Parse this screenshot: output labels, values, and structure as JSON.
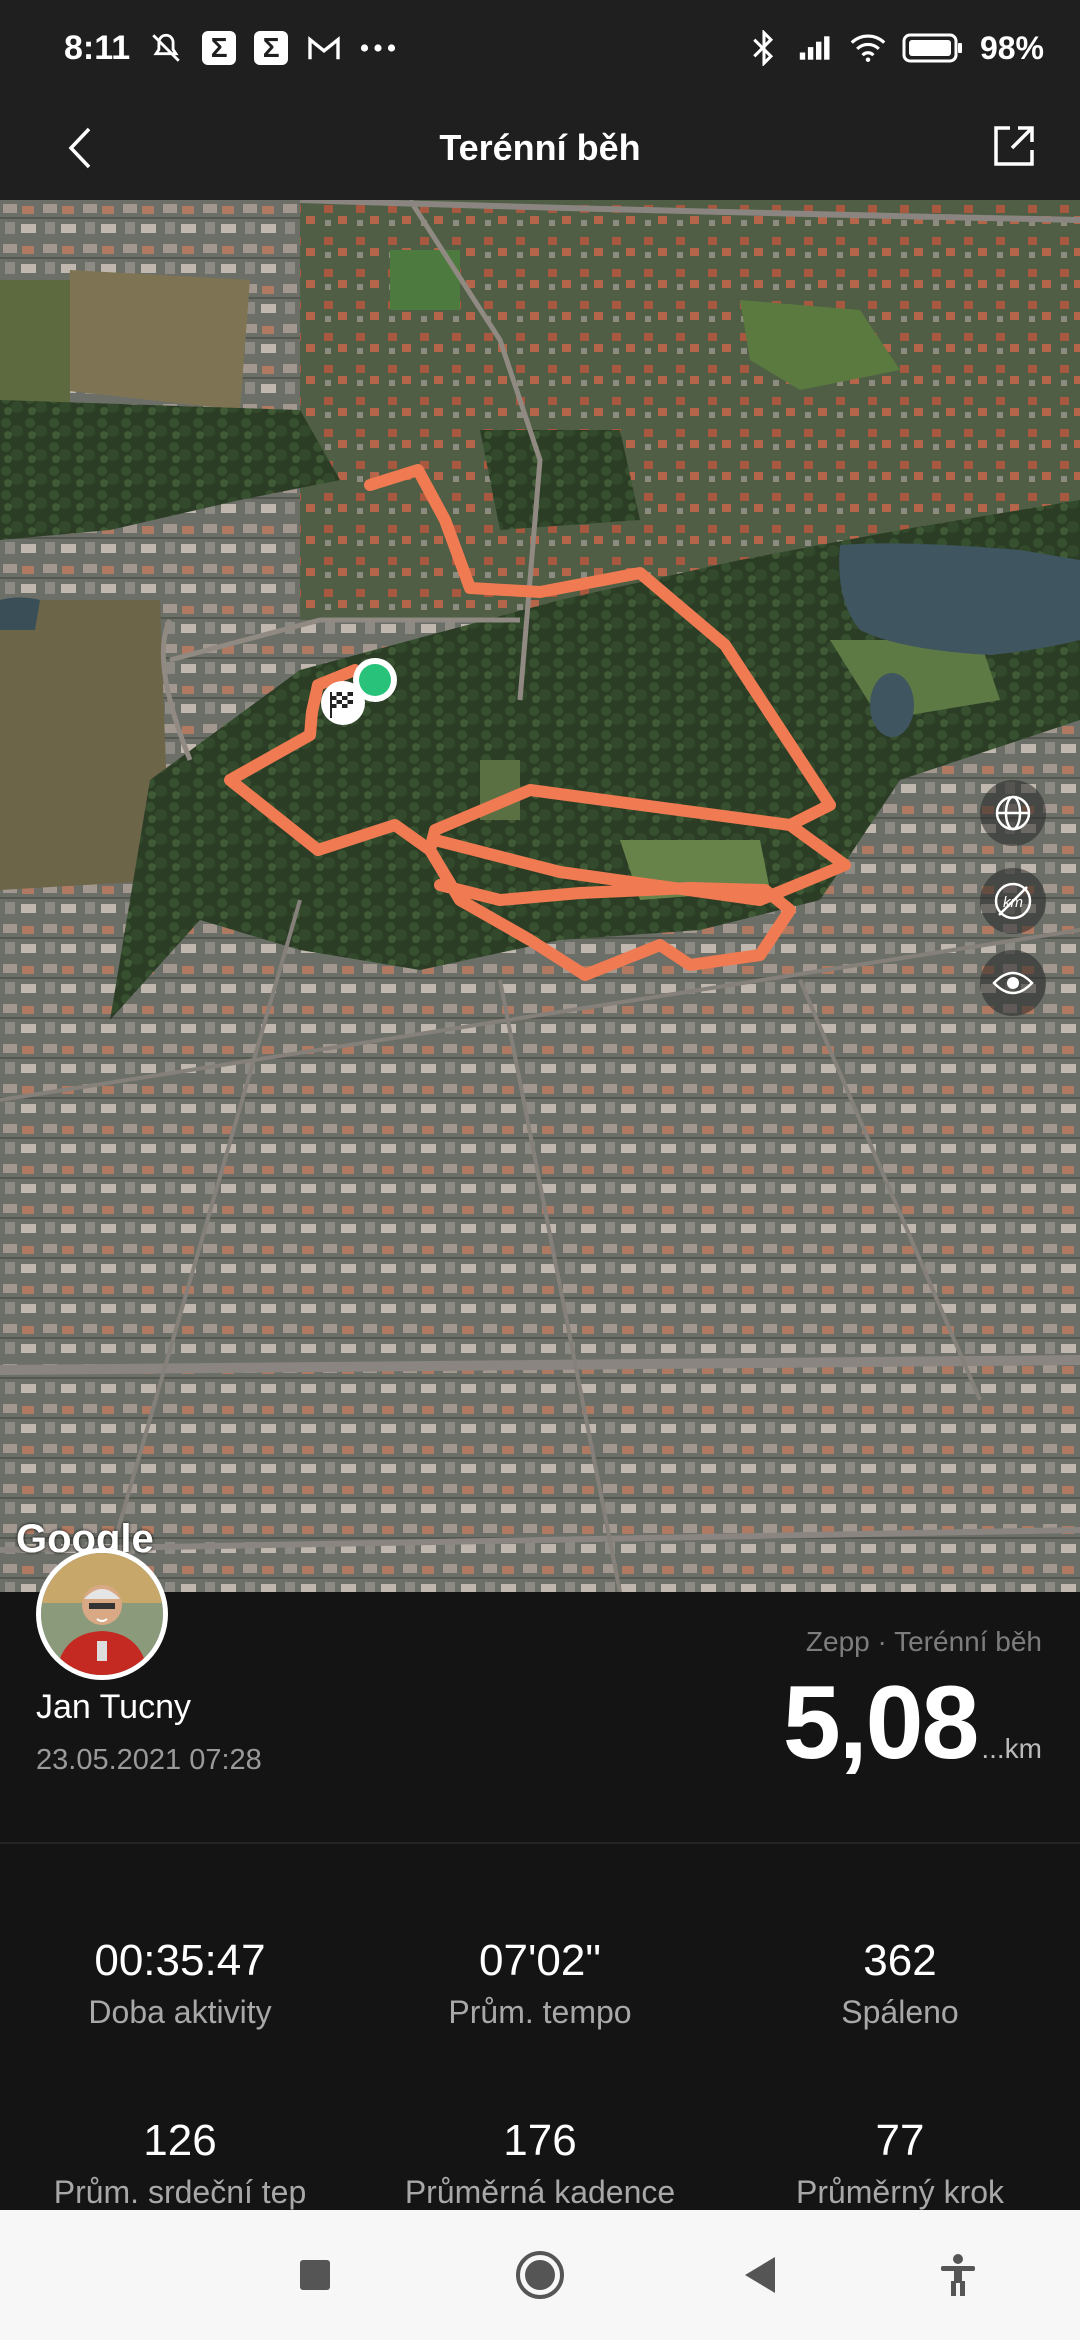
{
  "status_bar": {
    "time": "8:11",
    "battery": "98%",
    "icons_left": [
      "mute-icon",
      "sigma-icon",
      "sigma-icon",
      "gmail-icon",
      "more-dots-icon"
    ],
    "icons_right": [
      "bluetooth-icon",
      "signal-icon",
      "wifi-icon",
      "battery-icon"
    ]
  },
  "header": {
    "title": "Terénní běh"
  },
  "map": {
    "attribution": "Google",
    "route_color": "#f07a52",
    "controls": [
      "globe-icon",
      "km-off-icon",
      "eye-icon"
    ]
  },
  "profile": {
    "name": "Jan Tucny",
    "datetime": "23.05.2021 07:28",
    "source": "Zepp · Terénní běh",
    "distance_value": "5,08",
    "distance_unit": "...km"
  },
  "stats": [
    {
      "value": "00:35:47",
      "label": "Doba aktivity"
    },
    {
      "value": "07'02\"",
      "label": "Prům. tempo"
    },
    {
      "value": "362",
      "label": "Spáleno"
    },
    {
      "value": "126",
      "label": "Prům. srdeční tep"
    },
    {
      "value": "176",
      "label": "Průměrná kadence"
    },
    {
      "value": "77",
      "label": "Průměrný krok"
    }
  ],
  "navbar": [
    "recents-icon",
    "home-icon",
    "back-icon",
    "accessibility-icon"
  ]
}
